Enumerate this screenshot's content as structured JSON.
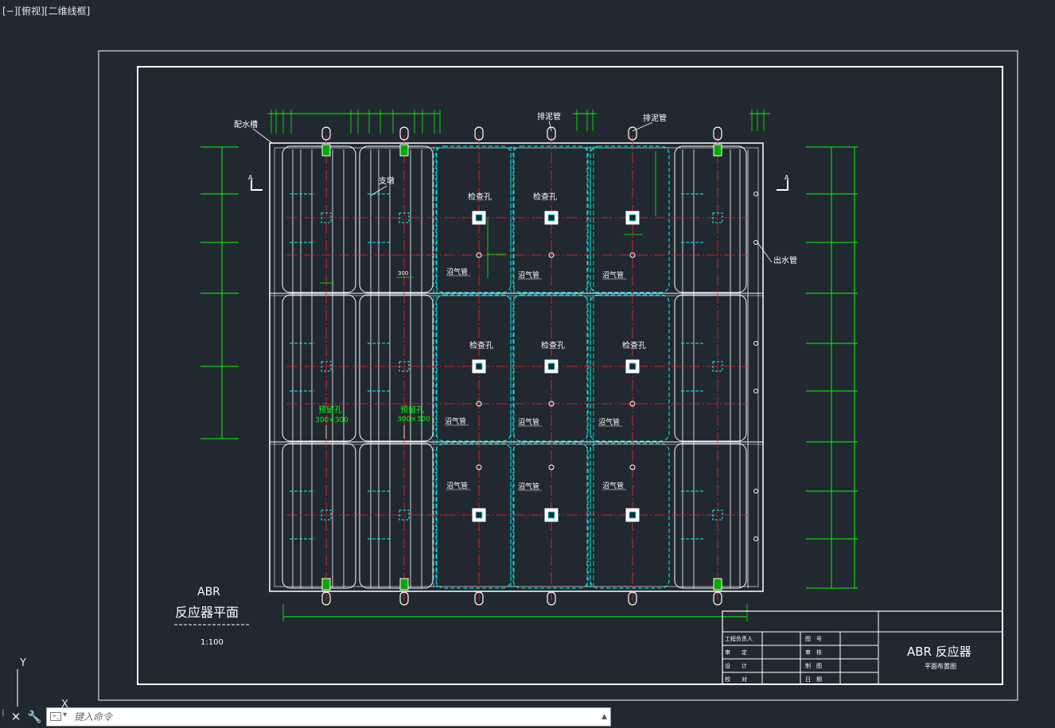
{
  "viewport": {
    "label": "[−][俯视][二维线框]"
  },
  "colors": {
    "background": "#212830",
    "white": "#ffffff",
    "green": "#00ff00",
    "cyan": "#00ffff",
    "red": "#ff2020"
  },
  "drawing": {
    "title_main": "ABR",
    "title_sub": "反应器平面",
    "scale": "1:100",
    "labels": {
      "distribution_tank": "配水槽",
      "mud_pipe_1": "排泥管",
      "mud_pipe_2": "排泥管",
      "support": "支墩",
      "outlet_pipe": "出水管",
      "section_left": "A",
      "section_right": "A",
      "dim_300_top": "300",
      "dim_300_mid": "300",
      "reserved_hole_1": "预留孔",
      "reserved_hole_1_size": "300×300",
      "reserved_hole_2": "预留孔",
      "reserved_hole_2_size": "300×300"
    },
    "inspection_holes": [
      "检查孔",
      "检查孔",
      "检查孔",
      "检查孔",
      "检查孔",
      "检查孔"
    ],
    "gas_pipes": [
      "沼气管",
      "沼气管",
      "沼气管",
      "沼气管",
      "沼气管",
      "沼气管",
      "沼气管",
      "沼气管",
      "沼气管"
    ]
  },
  "title_block": {
    "title": "ABR 反应器",
    "subtitle": "平面布置图",
    "rows": [
      {
        "label": "工程负责人",
        "label2": "图　号"
      },
      {
        "label": "审　　定",
        "label2": "审　核"
      },
      {
        "label": "设　　计",
        "label2": "制　图"
      },
      {
        "label": "校　　对",
        "label2": "日　期"
      }
    ]
  },
  "ucs": {
    "y_label": "Y",
    "x_label": "X"
  },
  "command_line": {
    "placeholder": "键入命令",
    "close_icon": "close-icon",
    "settings_icon": "wrench-icon"
  }
}
